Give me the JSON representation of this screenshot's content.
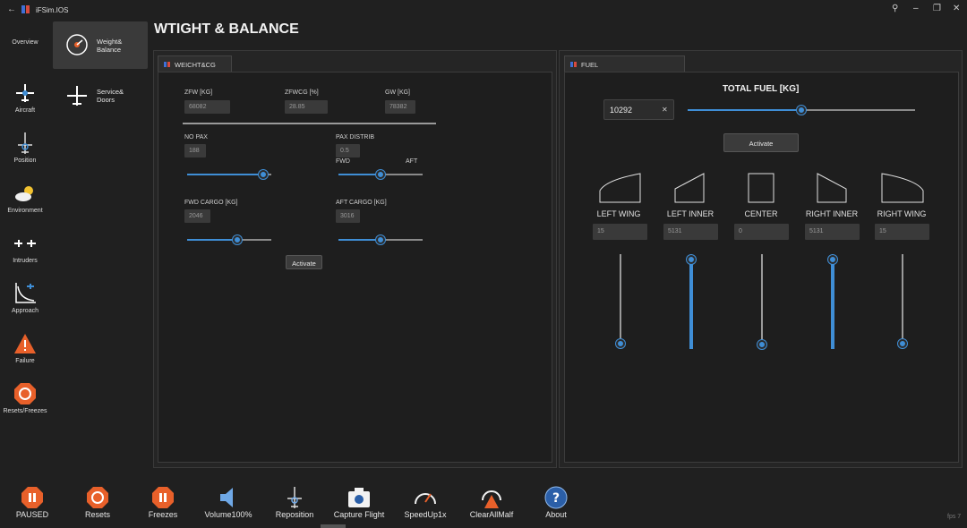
{
  "app": {
    "title": "iFSim.IOS"
  },
  "nav": {
    "overview": "Overview",
    "items": [
      {
        "label": "Aircraft"
      },
      {
        "label": "Position"
      },
      {
        "label": "Environment"
      },
      {
        "label": "Intruders"
      },
      {
        "label": "Approach"
      },
      {
        "label": "Failure"
      },
      {
        "label": "Resets/Freezes"
      }
    ],
    "sub": [
      {
        "label": "Weight&\nBalance"
      },
      {
        "label": "Service&\nDoors"
      }
    ]
  },
  "page": {
    "title": "WTIGHT & BALANCE"
  },
  "weight": {
    "tab": "WEICHT&CG",
    "zfw_label": "ZFW [KG]",
    "zfw_value": "68082",
    "zfwcg_label": "ZFWCG [%]",
    "zfwcg_value": "28.85",
    "gw_label": "GW [KG]",
    "gw_value": "78382",
    "nopax_label": "NO PAX",
    "nopax_value": "188",
    "nopax_level": 0.9,
    "paxdistrib_label": "PAX DISTRIB",
    "paxdistrib_value": "0.5",
    "paxdistrib_level": 0.5,
    "fwd_label": "FWD",
    "aft_label": "AFT",
    "fwdcargo_label": "FWD CARGO [KG]",
    "fwdcargo_value": "2046",
    "fwdcargo_level": 0.6,
    "aftcargo_label": "AFT CARGO [KG]",
    "aftcargo_value": "3016",
    "aftcargo_level": 0.5,
    "activate": "Activate"
  },
  "fuel": {
    "tab": "FUEL",
    "total_label": "TOTAL FUEL [KG]",
    "total_value": "10292",
    "total_level": 0.5,
    "activate": "Activate",
    "tanks": [
      {
        "label": "LEFT WING",
        "value": "15",
        "level": 0.06
      },
      {
        "label": "LEFT INNER",
        "value": "5131",
        "level": 0.94
      },
      {
        "label": "CENTER",
        "value": "0",
        "level": 0.05
      },
      {
        "label": "RIGHT INNER",
        "value": "5131",
        "level": 0.94
      },
      {
        "label": "RIGHT WING",
        "value": "15",
        "level": 0.06
      }
    ]
  },
  "bottom": [
    {
      "label": "PAUSED"
    },
    {
      "label": "Resets"
    },
    {
      "label": "Freezes"
    },
    {
      "label": "Volume100%"
    },
    {
      "label": "Reposition"
    },
    {
      "label": "Capture Flight"
    },
    {
      "label": "SpeedUp1x"
    },
    {
      "label": "ClearAllMalf"
    },
    {
      "label": "About"
    }
  ],
  "fps": "fps 7",
  "colors": {
    "accent": "#3f8ed6",
    "warning": "#e8602a",
    "background": "#202020"
  }
}
